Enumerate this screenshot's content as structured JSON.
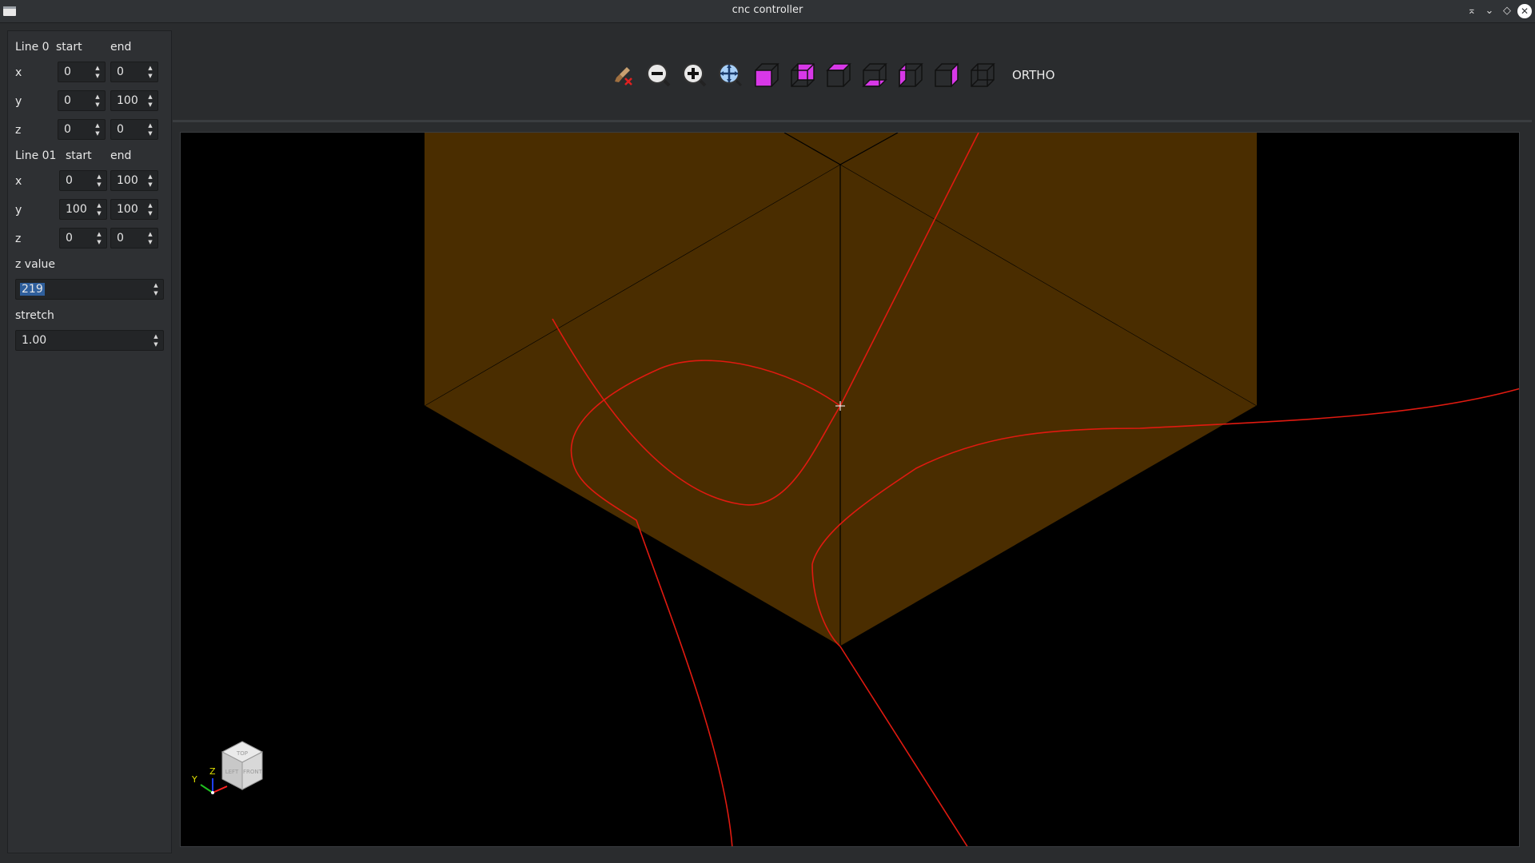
{
  "window": {
    "title": "cnc controller"
  },
  "lines": [
    {
      "label": "Line 0",
      "start_label": "start",
      "end_label": "end",
      "rows": [
        {
          "axis": "x",
          "start": "0",
          "end": "0"
        },
        {
          "axis": "y",
          "start": "0",
          "end": "100"
        },
        {
          "axis": "z",
          "start": "0",
          "end": "0"
        }
      ]
    },
    {
      "label": "Line 01",
      "start_label": "start",
      "end_label": "end",
      "rows": [
        {
          "axis": "x",
          "start": "0",
          "end": "100"
        },
        {
          "axis": "y",
          "start": "100",
          "end": "100"
        },
        {
          "axis": "z",
          "start": "0",
          "end": "0"
        }
      ]
    }
  ],
  "z_value": {
    "label": "z value",
    "value": "219"
  },
  "stretch": {
    "label": "stretch",
    "value": "1.00"
  },
  "toolbar": {
    "tools": [
      "clear-brush-icon",
      "zoom-out-icon",
      "zoom-in-icon",
      "fit-all-icon",
      "view-front-icon",
      "view-back-icon",
      "view-top-icon",
      "view-bottom-icon",
      "view-left-icon",
      "view-right-icon",
      "view-iso-icon"
    ],
    "ortho_label": "ORTHO"
  },
  "view_cube": {
    "top": "TOP",
    "left": "LEFT",
    "front": "FRONT",
    "axis_y": "Y",
    "axis_z": "Z"
  },
  "colors": {
    "surface": "#4a2d00",
    "curve": "#e01a10",
    "accent": "#d838e8"
  }
}
